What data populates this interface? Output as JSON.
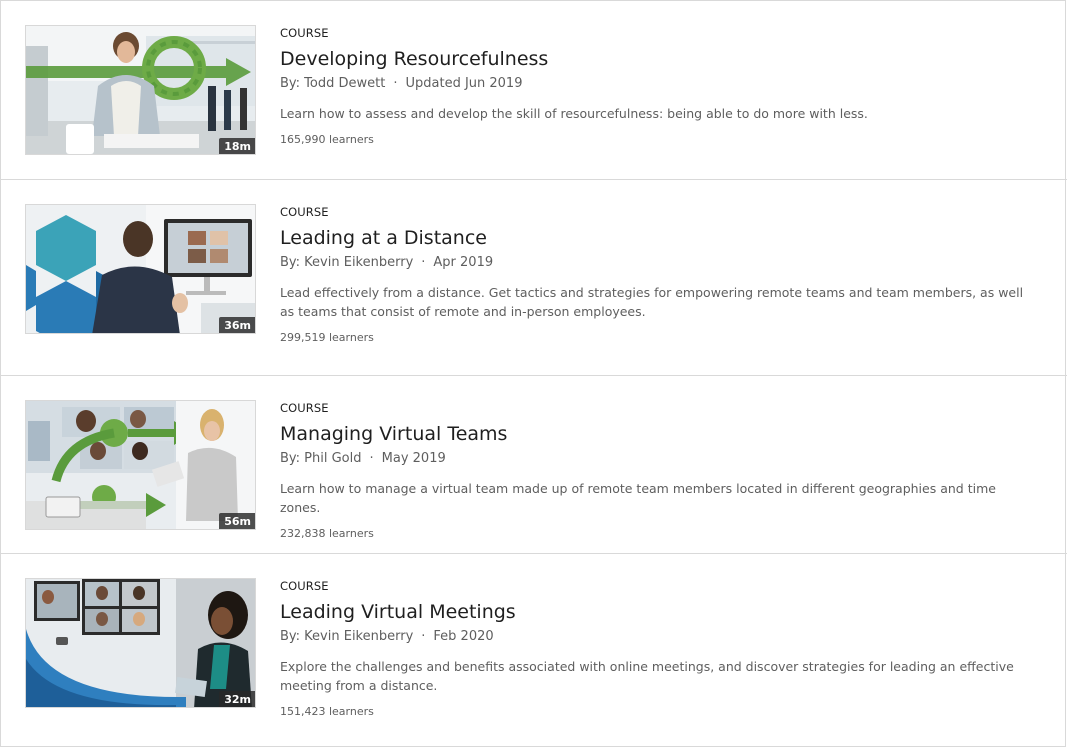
{
  "courses": [
    {
      "kind": "COURSE",
      "title": "Developing Resourcefulness",
      "author": "By: Todd Dewett",
      "separator": "·",
      "date": "Updated Jun 2019",
      "description": "Learn how to assess and develop the skill of resourcefulness: being able to do more with less.",
      "learners": "165,990 learners",
      "duration": "18m"
    },
    {
      "kind": "COURSE",
      "title": "Leading at a Distance",
      "author": "By: Kevin Eikenberry",
      "separator": "·",
      "date": "Apr 2019",
      "description": "Lead effectively from a distance. Get tactics and strategies for empowering remote teams and team members, as well as teams that consist of remote and in-person employees.",
      "learners": "299,519 learners",
      "duration": "36m"
    },
    {
      "kind": "COURSE",
      "title": "Managing Virtual Teams",
      "author": "By: Phil Gold",
      "separator": "·",
      "date": "May 2019",
      "description": "Learn how to manage a virtual team made up of remote team members located in different geographies and time zones.",
      "learners": "232,838 learners",
      "duration": "56m"
    },
    {
      "kind": "COURSE",
      "title": "Leading Virtual Meetings",
      "author": "By: Kevin Eikenberry",
      "separator": "·",
      "date": "Feb 2020",
      "description": "Explore the challenges and benefits associated with online meetings, and discover strategies for leading an effective meeting from a distance.",
      "learners": "151,423 learners",
      "duration": "32m"
    }
  ],
  "colors": {
    "border": "#d9d9d9",
    "text_primary": "#1f1f1f",
    "text_secondary": "#5e5e5e",
    "duration_badge": "#282828"
  }
}
